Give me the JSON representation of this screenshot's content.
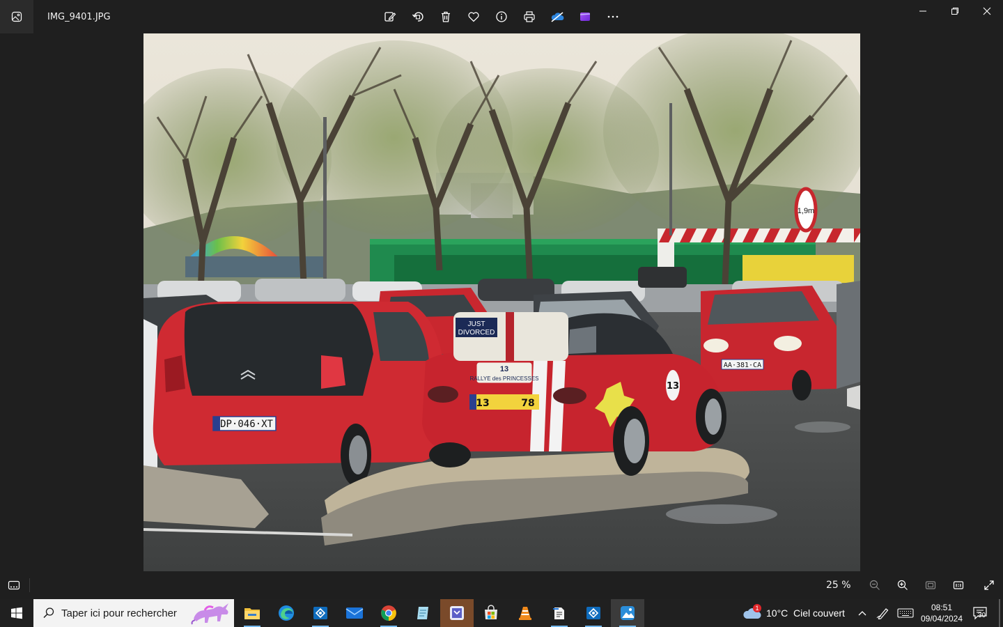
{
  "window": {
    "file_name": "IMG_9401.JPG",
    "toolbar": [
      {
        "name": "edit-icon"
      },
      {
        "name": "rotate-icon"
      },
      {
        "name": "delete-icon"
      },
      {
        "name": "favorite-icon"
      },
      {
        "name": "info-icon"
      },
      {
        "name": "print-icon"
      },
      {
        "name": "onedrive-icon"
      },
      {
        "name": "clipchamp-icon"
      },
      {
        "name": "more-icon"
      }
    ],
    "controls": [
      "minimize-icon",
      "maximize-icon",
      "close-icon"
    ]
  },
  "photo": {
    "plates": {
      "citroen": "DP·046·XT",
      "renault": "AA·381·CA",
      "mazda_number": "13",
      "mazda_plate_num": "78"
    },
    "stickers": {
      "just_divorced_line1": "JUST",
      "just_divorced_line2": "DIVORCED",
      "rallye_number": "13",
      "rallye_text": "RALLYE des PRINCESSES",
      "race_number": "13",
      "height_sign": "1,9m"
    }
  },
  "viewer_bar": {
    "zoom_label": "25 %"
  },
  "taskbar": {
    "search_placeholder": "Taper ici pour rechercher",
    "weather_temp": "10°C",
    "weather_text": "Ciel couvert",
    "weather_badge": "1",
    "time": "08:51",
    "date": "09/04/2024",
    "notifications_count": "30",
    "colors": {
      "active_underline": "#76b9ed",
      "taskbar_bg": "#202020"
    }
  }
}
